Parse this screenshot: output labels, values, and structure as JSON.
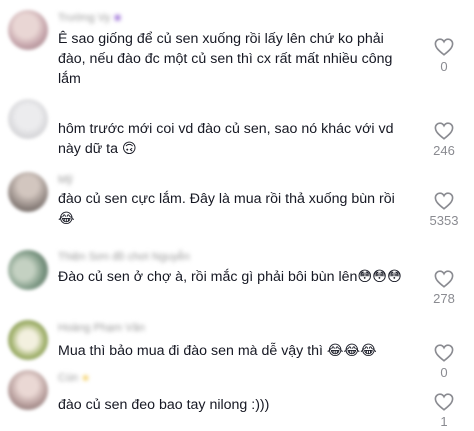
{
  "comments": [
    {
      "username": "Trường Vy",
      "username_badge": "■",
      "text": "Ê sao giống để củ sen xuống rồi lấy lên chứ ko phải đào, nếu đào đc một củ sen thì cx rất mất nhiều công lắm",
      "likes": "0",
      "avatar_color": "#c7a7ad"
    },
    {
      "username": "",
      "text": "hôm trước mới coi vd đào củ sen, sao nó khác với vd này dữ ta 🙃",
      "likes": "246",
      "avatar_color": "#d5d5d8"
    },
    {
      "username": "Mỹ",
      "text": "đào củ sen cực lắm. Đây là mua rồi thả xuống bùn rồi 😂",
      "likes": "5353",
      "avatar_color": "#9a8f8a"
    },
    {
      "username": "Thiện Sơn đồ chơi Nguyễn",
      "text": "Đào củ sen ở chợ à, rồi mắc gì phải bôi bùn lên😳😳😳",
      "likes": "278",
      "avatar_color": "#7f9a86"
    },
    {
      "username": "Hoàng Phạm Vân",
      "text": "Mua thì bảo mua đi đào sen mà dễ vậy thì 😂😂😂",
      "likes": "0",
      "avatar_color": "#9fb06a"
    },
    {
      "username": "Cún",
      "username_badge": "●",
      "text": "đào củ sen đeo bao tay nilong :)))",
      "likes": "1",
      "avatar_color": "#b9a09e"
    }
  ]
}
